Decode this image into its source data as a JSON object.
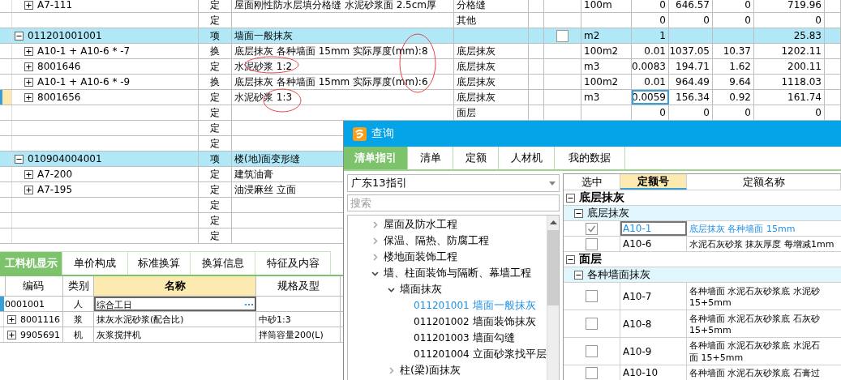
{
  "main_table": {
    "rows": [
      {
        "kind": "quota",
        "code": "A7-111",
        "expanded": false,
        "type": "定",
        "name": "屋面刚性防水层填分格缝 水泥砂浆面 2.5cm厚",
        "spec": "分格缝",
        "unit": "100m",
        "quantity": "0",
        "price": "646.57",
        "column_9": "0",
        "total": "719.96",
        "selected": false
      },
      {
        "kind": "blank",
        "type": "定",
        "spec": "其他",
        "quantity": "0",
        "price": "0",
        "column_9": "0",
        "total": "0",
        "selected": false
      },
      {
        "kind": "item",
        "code": "011201001001",
        "expanded": true,
        "type": "项",
        "name": "墙面一般抹灰",
        "checked": false,
        "unit": "m2",
        "quantity": "1",
        "total": "25.83",
        "selected": false
      },
      {
        "kind": "quota",
        "code": "A10-1 + A10-6 * -7",
        "expanded": false,
        "type": "换",
        "name": "底层抹灰 各种墙面 15mm  实际厚度(mm):8",
        "spec": "底层抹灰",
        "unit": "100m2",
        "quantity": "0.01",
        "price": "1037.05",
        "column_9": "10.37",
        "total": "1202.11",
        "selected": false
      },
      {
        "kind": "quota",
        "code": "8001646",
        "expanded": false,
        "type": "定",
        "name": "水泥砂浆 1:2",
        "spec": "底层抹灰",
        "unit": "m3",
        "quantity": "0.0083",
        "price": "194.71",
        "column_9": "1.62",
        "total": "200.11",
        "selected": false
      },
      {
        "kind": "quota",
        "code": "A10-1 + A10-6 * -9",
        "expanded": false,
        "type": "换",
        "name": "底层抹灰 各种墙面 15mm  实际厚度(mm):6",
        "spec": "底层抹灰",
        "unit": "100m2",
        "quantity": "0.01",
        "price": "964.49",
        "column_9": "9.64",
        "total": "1118.03",
        "selected": false
      },
      {
        "kind": "quota",
        "code": "8001656",
        "expanded": false,
        "type": "定",
        "name": "水泥砂浆 1:3",
        "spec": "底层抹灰",
        "unit": "m3",
        "quantity": "0.0059",
        "price": "156.34",
        "column_9": "0.92",
        "total": "161.74",
        "selected": true
      },
      {
        "kind": "blank",
        "type": "定",
        "spec": "面层",
        "quantity": "0",
        "price": "0",
        "column_9": "0",
        "total": "0",
        "selected": false
      },
      {
        "kind": "blank",
        "type": "定",
        "selected": false
      },
      {
        "kind": "blank",
        "type": "定",
        "selected": false
      },
      {
        "kind": "item",
        "code": "010904004001",
        "expanded": true,
        "type": "项",
        "name": "楼(地)面变形缝",
        "selected": false
      },
      {
        "kind": "quota",
        "code": "A7-200",
        "expanded": false,
        "type": "定",
        "name": "建筑油膏",
        "selected": false
      },
      {
        "kind": "quota",
        "code": "A7-195",
        "expanded": false,
        "type": "定",
        "name": "油浸麻丝 立面",
        "selected": false
      },
      {
        "kind": "blank",
        "type": "定",
        "selected": false
      },
      {
        "kind": "blank",
        "type": "定",
        "selected": false
      },
      {
        "kind": "blank",
        "type": "定",
        "selected": false
      }
    ]
  },
  "detail": {
    "tabs": [
      {
        "label": "工料机显示",
        "selected": true
      },
      {
        "label": "单价构成",
        "selected": false
      },
      {
        "label": "标准换算",
        "selected": false
      },
      {
        "label": "换算信息",
        "selected": false
      },
      {
        "label": "特征及内容",
        "selected": false
      }
    ],
    "columns": [
      {
        "label": "编码",
        "highlighted": false
      },
      {
        "label": "类别",
        "highlighted": false
      },
      {
        "label": "名称",
        "highlighted": true
      },
      {
        "label": "规格及型",
        "highlighted": false
      }
    ],
    "rows": [
      {
        "code": "0001001",
        "category": "人",
        "name": "综合工日",
        "editing": true,
        "selected": true
      },
      {
        "code": "8001116",
        "expanded": false,
        "category": "浆",
        "name": "抹灰水泥砂浆(配合比)",
        "spec": "中砂1:3",
        "editing": false,
        "selected": false
      },
      {
        "code": "9905691",
        "expanded": false,
        "category": "机",
        "name": "灰浆搅拌机",
        "spec": "拌筒容量200(L)",
        "editing": false,
        "selected": false
      }
    ]
  },
  "dialog": {
    "title": "查询",
    "tabs": [
      {
        "label": "清单指引",
        "selected": true
      },
      {
        "label": "清单",
        "selected": false
      },
      {
        "label": "定额",
        "selected": false
      },
      {
        "label": "人材机",
        "selected": false
      },
      {
        "label": "我的数据",
        "selected": false
      }
    ],
    "library": "广东13指引",
    "search": {
      "placeholder": "搜索"
    },
    "tree": [
      {
        "kind": "folder",
        "label": "屋面及防水工程",
        "expanded": false
      },
      {
        "kind": "folder",
        "label": "保温、隔热、防腐工程",
        "expanded": false
      },
      {
        "kind": "folder",
        "label": "楼地面装饰工程",
        "expanded": false
      },
      {
        "kind": "folder",
        "label": "墙、柱面装饰与隔断、幕墙工程",
        "expanded": true,
        "children": [
          {
            "kind": "folder",
            "label": "墙面抹灰",
            "expanded": true,
            "children": [
              {
                "kind": "entry",
                "code": "011201001",
                "label": "墙面一般抹灰",
                "selected": true
              },
              {
                "kind": "entry",
                "code": "011201002",
                "label": "墙面装饰抹灰",
                "selected": false
              },
              {
                "kind": "entry",
                "code": "011201003",
                "label": "墙面勾缝",
                "selected": false
              },
              {
                "kind": "entry",
                "code": "011201004",
                "label": "立面砂浆找平层",
                "selected": false
              }
            ]
          },
          {
            "kind": "folder",
            "label": "柱(梁)面抹灰",
            "expanded": false
          }
        ]
      }
    ],
    "quota_table": {
      "columns": [
        {
          "label": "选中",
          "highlighted": false
        },
        {
          "label": "定额号",
          "highlighted": true
        },
        {
          "label": "定额名称",
          "highlighted": false
        }
      ],
      "groups": [
        {
          "name": "底层抹灰",
          "expanded": true,
          "children": [
            {
              "name": "底层抹灰",
              "expanded": true,
              "items": [
                {
                  "code": "A10-1",
                  "name_lines": [
                    "底层抹灰 各种墙面 15mm"
                  ],
                  "checked": true,
                  "selected": true
                },
                {
                  "code": "A10-6",
                  "name_lines": [
                    "水泥石灰砂浆 抹灰厚度 每增减1mm"
                  ],
                  "checked": false,
                  "selected": false
                }
              ]
            }
          ]
        },
        {
          "name": "面层",
          "expanded": true,
          "children": [
            {
              "name": "各种墙面抹灰",
              "expanded": true,
              "items": [
                {
                  "code": "A10-7",
                  "name_lines": [
                    "各种墙面 水泥石灰砂浆底 水泥砂",
                    "15+5mm"
                  ],
                  "checked": false,
                  "selected": false
                },
                {
                  "code": "A10-8",
                  "name_lines": [
                    "各种墙面 水泥石灰砂浆底 石灰砂",
                    "15+5mm"
                  ],
                  "checked": false,
                  "selected": false
                },
                {
                  "code": "A10-9",
                  "name_lines": [
                    "各种墙面 水泥石灰砂浆底 水泥石",
                    "面 15+5mm"
                  ],
                  "checked": false,
                  "selected": false
                },
                {
                  "code": "A10-10",
                  "name_lines": [
                    "各种墙面 水泥石灰砂浆底 石膏过"
                  ],
                  "checked": false,
                  "selected": false
                }
              ]
            }
          ]
        }
      ]
    }
  }
}
